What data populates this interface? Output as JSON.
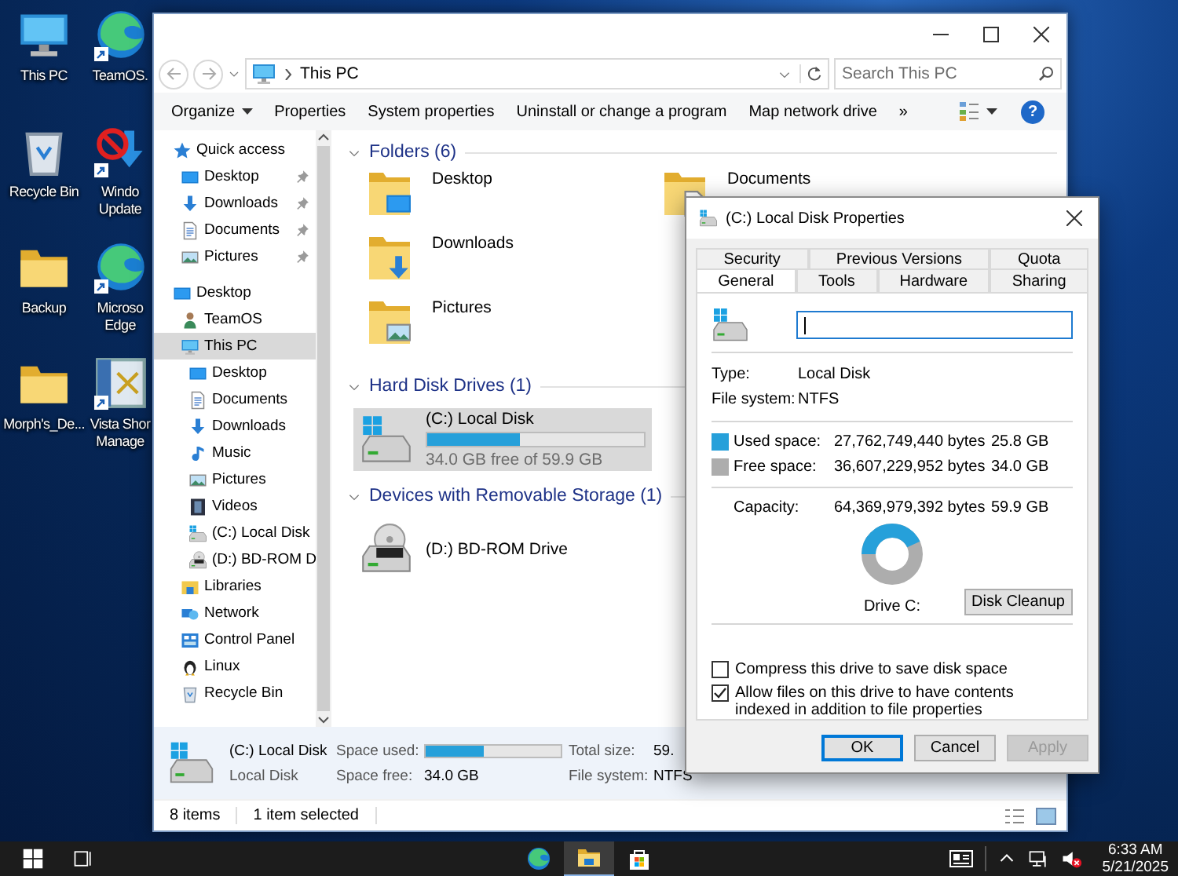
{
  "desktop": {
    "icons": [
      {
        "label": "This PC",
        "kind": "pc",
        "shortcut": false
      },
      {
        "label": "Recycle Bin",
        "kind": "recycle",
        "shortcut": false
      },
      {
        "label": "Backup",
        "kind": "folder",
        "shortcut": false
      },
      {
        "label": "Morph's_De...",
        "kind": "folder",
        "shortcut": false
      },
      {
        "label": "TeamOS.",
        "kind": "edge",
        "shortcut": true
      },
      {
        "label": "Windo Update",
        "kind": "update",
        "shortcut": true
      },
      {
        "label": "Microso Edge",
        "kind": "edge",
        "shortcut": true
      },
      {
        "label": "Vista Shor Manage",
        "kind": "vista",
        "shortcut": true
      }
    ]
  },
  "explorer": {
    "back": {
      "disabled": true
    },
    "forward": {
      "disabled": true
    },
    "address": "This PC",
    "search": {
      "placeholder": "Search This PC"
    },
    "commands": [
      {
        "label": "Organize",
        "kind": "menu"
      },
      {
        "label": "Properties",
        "kind": "plain"
      },
      {
        "label": "System properties",
        "kind": "plain"
      },
      {
        "label": "Uninstall or change a program",
        "kind": "plain"
      },
      {
        "label": "Map network drive",
        "kind": "plain"
      },
      {
        "label": "»",
        "kind": "plain"
      }
    ],
    "help": "?",
    "navigation": [
      {
        "label": "Quick access",
        "kind": "star",
        "selected": false,
        "children": [
          {
            "label": "Desktop",
            "kind": "desktop",
            "pinned": true,
            "selected": false
          },
          {
            "label": "Downloads",
            "kind": "downloads",
            "pinned": true,
            "selected": false
          },
          {
            "label": "Documents",
            "kind": "documents",
            "pinned": true,
            "selected": false
          },
          {
            "label": "Pictures",
            "kind": "pictures",
            "pinned": true,
            "selected": false
          }
        ]
      },
      {
        "label": "Desktop",
        "kind": "desktop",
        "selected": false,
        "children": [
          {
            "label": "TeamOS",
            "kind": "user",
            "selected": false
          },
          {
            "label": "This PC",
            "kind": "pc",
            "selected": true,
            "children": [
              {
                "label": "Desktop",
                "kind": "desktop",
                "selected": false
              },
              {
                "label": "Documents",
                "kind": "documents",
                "selected": false
              },
              {
                "label": "Downloads",
                "kind": "downloads",
                "selected": false
              },
              {
                "label": "Music",
                "kind": "music",
                "selected": false
              },
              {
                "label": "Pictures",
                "kind": "pictures",
                "selected": false
              },
              {
                "label": "Videos",
                "kind": "videos",
                "selected": false
              },
              {
                "label": "(C:) Local Disk",
                "kind": "drive",
                "selected": false
              },
              {
                "label": "(D:) BD-ROM D",
                "kind": "bd",
                "selected": false
              }
            ]
          },
          {
            "label": "Libraries",
            "kind": "libraries",
            "selected": false
          },
          {
            "label": "Network",
            "kind": "network",
            "selected": false
          },
          {
            "label": "Control Panel",
            "kind": "control",
            "selected": false
          },
          {
            "label": "Linux",
            "kind": "penguin",
            "selected": false
          },
          {
            "label": "Recycle Bin",
            "kind": "recycle",
            "selected": false
          }
        ]
      }
    ],
    "sections": [
      {
        "title": "Folders (6)",
        "kind": "folders",
        "items": [
          {
            "label": "Desktop",
            "kind": "desktop"
          },
          {
            "label": "Downloads",
            "kind": "downloads"
          },
          {
            "label": "Pictures",
            "kind": "pictures"
          },
          {
            "label": "Documents",
            "kind": "documents"
          }
        ]
      },
      {
        "title": "Hard Disk Drives (1)",
        "kind": "drives",
        "items": [
          {
            "label": "(C:) Local Disk",
            "kind": "drive",
            "selected": true,
            "level": 0.431,
            "caption": "34.0 GB free of 59.9 GB"
          }
        ]
      },
      {
        "title": "Devices with Removable Storage (1)",
        "kind": "drives",
        "items": [
          {
            "label": "(D:) BD-ROM Drive",
            "kind": "bd",
            "selected": false
          }
        ]
      }
    ],
    "details": {
      "title": "(C:) Local Disk",
      "subtitle": "Local Disk",
      "space_used": {
        "label": "Space used:",
        "level": 0.431
      },
      "space_free": {
        "label": "Space free:",
        "value": "34.0 GB"
      },
      "total_size": {
        "label": "Total size:",
        "value": "59."
      },
      "file_system": {
        "label": "File system:",
        "value": "NTFS"
      }
    },
    "status": [
      "8 items",
      "1 item selected"
    ]
  },
  "properties": {
    "title": "(C:) Local Disk Properties",
    "tab_rows": [
      {
        "tabs": [
          {
            "label": "Security",
            "selected": false
          },
          {
            "label": "Previous Versions",
            "selected": false
          },
          {
            "label": "Quota",
            "selected": false
          }
        ]
      },
      {
        "tabs": [
          {
            "label": "General",
            "selected": true
          },
          {
            "label": "Tools",
            "selected": false
          },
          {
            "label": "Hardware",
            "selected": false
          },
          {
            "label": "Sharing",
            "selected": false
          }
        ]
      }
    ],
    "name_field": {
      "focused": true
    },
    "info": [
      {
        "label": "Type:",
        "value": "Local Disk"
      },
      {
        "label": "File system:",
        "value": "NTFS"
      }
    ],
    "space": [
      {
        "label": "Used space:",
        "bytes": "27,762,749,440 bytes",
        "size": "25.8 GB",
        "color": "#26a0da"
      },
      {
        "label": "Free space:",
        "bytes": "36,607,229,952 bytes",
        "size": "34.0 GB",
        "color": "#adadad"
      }
    ],
    "capacity": {
      "label": "Capacity:",
      "bytes": "64,369,979,392 bytes",
      "size": "59.9 GB"
    },
    "usage_ring": {
      "level": 0.431,
      "caption": "Drive C:"
    },
    "cleanup_button": "Disk Cleanup",
    "options": [
      {
        "label": "Compress this drive to save disk space",
        "checked": false
      },
      {
        "label": "Allow files on this drive to have contents indexed in addition to file properties",
        "checked": true
      }
    ],
    "buttons": [
      {
        "label": "OK",
        "kind": "default",
        "disabled": false
      },
      {
        "label": "Cancel",
        "kind": "normal",
        "disabled": false
      },
      {
        "label": "Apply",
        "kind": "normal",
        "disabled": true
      }
    ]
  },
  "taskbar": {
    "apps": [
      {
        "kind": "edge",
        "active": false
      },
      {
        "kind": "explorer",
        "active": true
      },
      {
        "kind": "store",
        "active": false
      }
    ],
    "time": "6:33 AM",
    "date": "5/21/2025"
  }
}
